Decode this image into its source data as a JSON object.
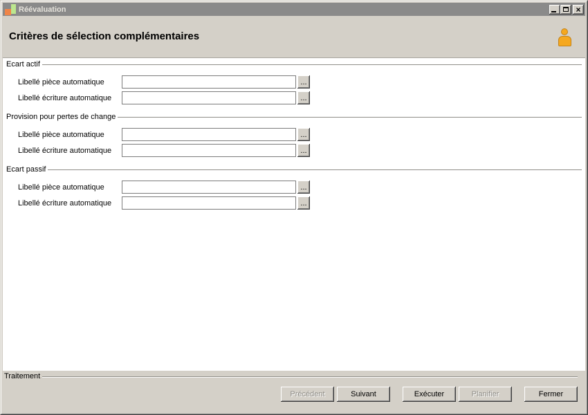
{
  "window": {
    "title": "Réévaluation",
    "icons": {
      "app_icon": "sage-blocks-icon",
      "minimize": "minimize-icon",
      "maximize": "maximize-icon",
      "close": "close-icon",
      "close_glyph": "×"
    }
  },
  "header": {
    "title": "Critères de sélection complémentaires",
    "icon": "person-icon"
  },
  "form": {
    "browse_label": "...",
    "groups": [
      {
        "title": "Ecart actif",
        "fields": [
          {
            "label": "Libellé pièce automatique",
            "value": ""
          },
          {
            "label": "Libellé écriture automatique",
            "value": ""
          }
        ]
      },
      {
        "title": "Provision pour pertes de change",
        "fields": [
          {
            "label": "Libellé pièce automatique",
            "value": ""
          },
          {
            "label": "Libellé écriture automatique",
            "value": ""
          }
        ]
      },
      {
        "title": "Ecart passif",
        "fields": [
          {
            "label": "Libellé pièce automatique",
            "value": ""
          },
          {
            "label": "Libellé écriture automatique",
            "value": ""
          }
        ]
      }
    ]
  },
  "footer": {
    "group_title": "Traitement",
    "buttons": [
      {
        "label": "Précédent",
        "enabled": false
      },
      {
        "label": "Suivant",
        "enabled": true
      },
      {
        "label": "Exécuter",
        "enabled": true
      },
      {
        "label": "Planifier",
        "enabled": false
      },
      {
        "label": "Fermer",
        "enabled": true
      }
    ]
  },
  "colors": {
    "window_face": "#D4D0C8",
    "titlebar": "#8A8A8A",
    "titlebar_text": "#E6E3DC",
    "panel_bg": "#FFFFFF",
    "app_icon_orange": "#EF8549",
    "app_icon_green": "#BCE78E",
    "person_icon_fill": "#F5A81F",
    "person_icon_border": "#C2821A",
    "disabled_text": "#8E8C86"
  }
}
